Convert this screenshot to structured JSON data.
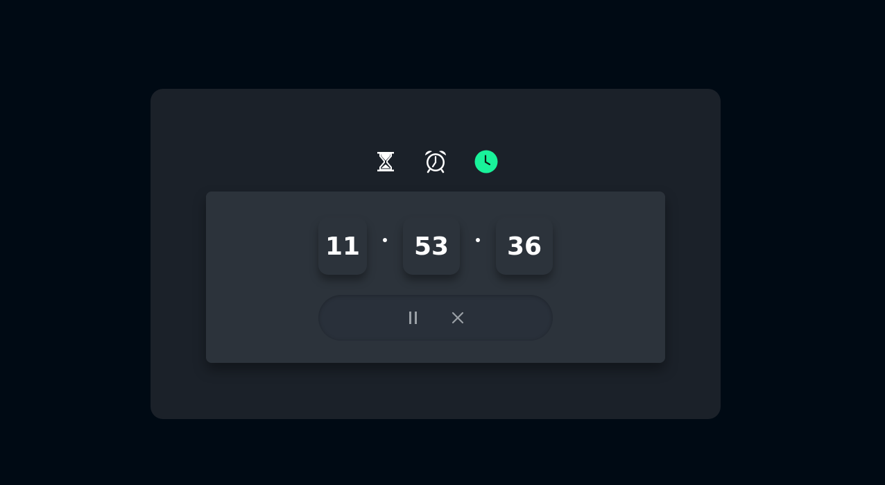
{
  "modes": [
    {
      "name": "timer",
      "icon": "hourglass-icon",
      "active": false
    },
    {
      "name": "alarm",
      "icon": "alarm-clock-icon",
      "active": false
    },
    {
      "name": "clock",
      "icon": "clock-icon",
      "active": true
    }
  ],
  "time": {
    "hours": "11",
    "minutes": "53",
    "seconds": "36"
  },
  "controls": {
    "pause_icon": "pause-icon",
    "close_icon": "close-icon"
  },
  "colors": {
    "background": "#000a14",
    "card": "#1b2129",
    "panel": "#2c333b",
    "accent": "#19f29a",
    "text": "#ffffff",
    "muted": "#9aa0a6"
  }
}
